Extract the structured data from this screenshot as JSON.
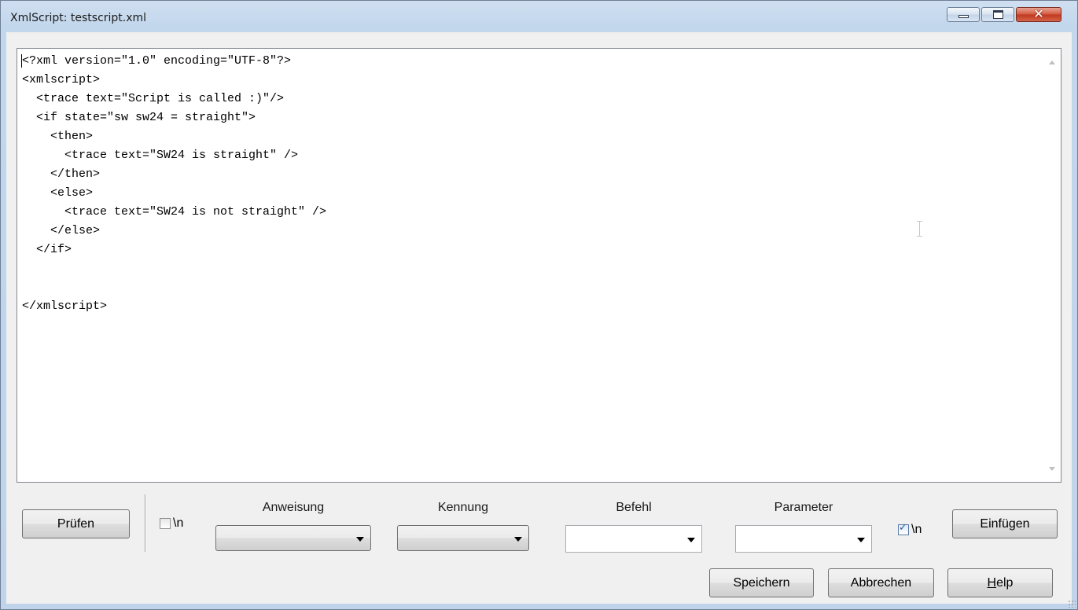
{
  "window": {
    "title": "XmlScript: testscript.xml",
    "controls": [
      "minimize",
      "maximize",
      "close"
    ],
    "close_glyph": "✕"
  },
  "editor": {
    "lines": [
      "<?xml version=\"1.0\" encoding=\"UTF-8\"?>",
      "<xmlscript>",
      "  <trace text=\"Script is called :)\"/>",
      "  <if state=\"sw sw24 = straight\">",
      "    <then>",
      "      <trace text=\"SW24 is straight\" />",
      "    </then>",
      "    <else>",
      "      <trace text=\"SW24 is not straight\" />",
      "    </else>",
      "  </if>",
      "",
      "",
      "</xmlscript>"
    ]
  },
  "toolbar": {
    "check_button": "Prüfen",
    "newline_before": {
      "label": "\\n",
      "checked": false
    },
    "statement": {
      "label": "Anweisung",
      "value": ""
    },
    "identifier": {
      "label": "Kennung",
      "value": ""
    },
    "command": {
      "label": "Befehl",
      "value": ""
    },
    "parameter": {
      "label": "Parameter",
      "value": ""
    },
    "newline_after": {
      "label": "\\n",
      "checked": true,
      "checkmark": "✓"
    },
    "insert_button": "Einfügen"
  },
  "footer": {
    "save_button": "Speichern",
    "cancel_button": "Abbrechen",
    "help_button_first": "H",
    "help_button_rest": "elp"
  },
  "colors": {
    "title_bar": "#c2d6ec",
    "close_button": "#c8452a",
    "client_background": "#f0f0f0"
  },
  "icons": {
    "minimize": "minimize-icon",
    "maximize": "maximize-icon",
    "close": "close-icon",
    "dropdown": "chevron-down-icon",
    "resize": "resize-grip-icon"
  }
}
